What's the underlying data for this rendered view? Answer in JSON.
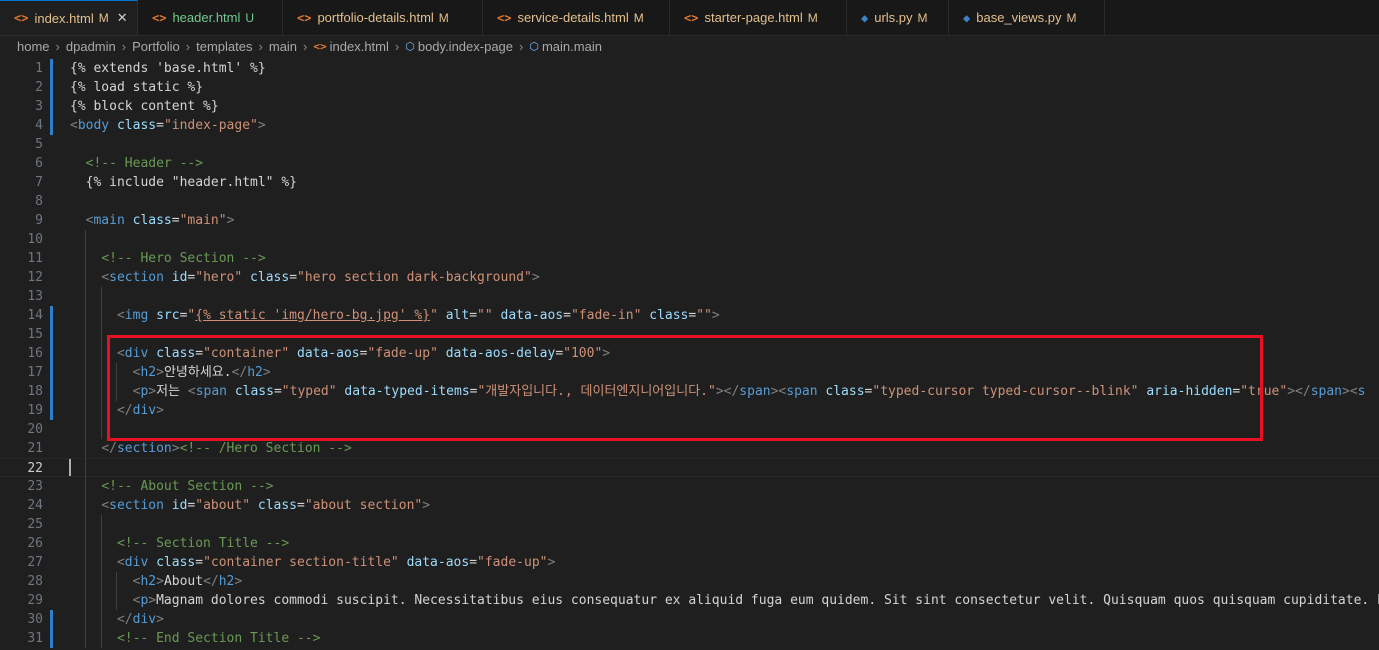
{
  "tabs": [
    {
      "icon": "html-file-icon",
      "icon_glyph": "<>",
      "name": "index.html",
      "badge": "M",
      "active": true,
      "close": "✕"
    },
    {
      "icon": "html-file-icon",
      "icon_glyph": "<>",
      "name": "header.html",
      "badge": "U",
      "active": false
    },
    {
      "icon": "html-file-icon",
      "icon_glyph": "<>",
      "name": "portfolio-details.html",
      "badge": "M",
      "active": false
    },
    {
      "icon": "html-file-icon",
      "icon_glyph": "<>",
      "name": "service-details.html",
      "badge": "M",
      "active": false
    },
    {
      "icon": "html-file-icon",
      "icon_glyph": "<>",
      "name": "starter-page.html",
      "badge": "M",
      "active": false
    },
    {
      "icon": "python-file-icon",
      "icon_glyph": "◆",
      "name": "urls.py",
      "badge": "M",
      "active": false
    },
    {
      "icon": "python-file-icon",
      "icon_glyph": "◆",
      "name": "base_views.py",
      "badge": "M",
      "active": false
    }
  ],
  "breadcrumb": [
    "home",
    "dpadmin",
    "Portfolio",
    "templates",
    "main",
    "index.html",
    "body.index-page",
    "main.main"
  ],
  "colors": {
    "accent": "#0078d4",
    "modified": "#e2c08d",
    "untracked": "#73c991",
    "highlight_box": "#e81123",
    "gutter_modified": "#2d7fca"
  },
  "lines": [
    {
      "n": "1",
      "segs": [
        [
          "t-tpl",
          "{% extends 'base.html' %}"
        ]
      ]
    },
    {
      "n": "2",
      "segs": [
        [
          "t-tpl",
          "{% load static %}"
        ]
      ]
    },
    {
      "n": "3",
      "segs": [
        [
          "t-tpl",
          "{% block content %}"
        ]
      ]
    },
    {
      "n": "4",
      "segs": [
        [
          "t-br",
          "<"
        ],
        [
          "t-tag",
          "body"
        ],
        [
          "t-text",
          " "
        ],
        [
          "t-attr",
          "class"
        ],
        [
          "t-text",
          "="
        ],
        [
          "t-str",
          "\"index-page\""
        ],
        [
          "t-br",
          ">"
        ]
      ]
    },
    {
      "n": "5",
      "segs": []
    },
    {
      "n": "6",
      "segs": [
        [
          "t-text",
          "  "
        ],
        [
          "t-com",
          "<!-- Header -->"
        ]
      ]
    },
    {
      "n": "7",
      "segs": [
        [
          "t-text",
          "  "
        ],
        [
          "t-tpl",
          "{% include \"header.html\" %}"
        ]
      ]
    },
    {
      "n": "8",
      "segs": []
    },
    {
      "n": "9",
      "segs": [
        [
          "t-text",
          "  "
        ],
        [
          "t-br",
          "<"
        ],
        [
          "t-tag",
          "main"
        ],
        [
          "t-text",
          " "
        ],
        [
          "t-attr",
          "class"
        ],
        [
          "t-text",
          "="
        ],
        [
          "t-str",
          "\"main\""
        ],
        [
          "t-br",
          ">"
        ]
      ]
    },
    {
      "n": "10",
      "segs": []
    },
    {
      "n": "11",
      "segs": [
        [
          "t-text",
          "    "
        ],
        [
          "t-com",
          "<!-- Hero Section -->"
        ]
      ]
    },
    {
      "n": "12",
      "segs": [
        [
          "t-text",
          "    "
        ],
        [
          "t-br",
          "<"
        ],
        [
          "t-tag",
          "section"
        ],
        [
          "t-text",
          " "
        ],
        [
          "t-attr",
          "id"
        ],
        [
          "t-text",
          "="
        ],
        [
          "t-str",
          "\"hero\""
        ],
        [
          "t-text",
          " "
        ],
        [
          "t-attr",
          "class"
        ],
        [
          "t-text",
          "="
        ],
        [
          "t-str",
          "\"hero section dark-background\""
        ],
        [
          "t-br",
          ">"
        ]
      ]
    },
    {
      "n": "13",
      "segs": []
    },
    {
      "n": "14",
      "segs": [
        [
          "t-text",
          "      "
        ],
        [
          "t-br",
          "<"
        ],
        [
          "t-tag",
          "img"
        ],
        [
          "t-text",
          " "
        ],
        [
          "t-attr",
          "src"
        ],
        [
          "t-text",
          "="
        ],
        [
          "t-str",
          "\""
        ],
        [
          "t-str t-und",
          "{% static 'img/hero-bg.jpg' %}"
        ],
        [
          "t-str",
          "\""
        ],
        [
          "t-text",
          " "
        ],
        [
          "t-attr",
          "alt"
        ],
        [
          "t-text",
          "="
        ],
        [
          "t-str",
          "\"\""
        ],
        [
          "t-text",
          " "
        ],
        [
          "t-attr",
          "data-aos"
        ],
        [
          "t-text",
          "="
        ],
        [
          "t-str",
          "\"fade-in\""
        ],
        [
          "t-text",
          " "
        ],
        [
          "t-attr",
          "class"
        ],
        [
          "t-text",
          "="
        ],
        [
          "t-str",
          "\"\""
        ],
        [
          "t-br",
          ">"
        ]
      ]
    },
    {
      "n": "15",
      "segs": []
    },
    {
      "n": "16",
      "segs": [
        [
          "t-text",
          "      "
        ],
        [
          "t-br",
          "<"
        ],
        [
          "t-tag",
          "div"
        ],
        [
          "t-text",
          " "
        ],
        [
          "t-attr",
          "class"
        ],
        [
          "t-text",
          "="
        ],
        [
          "t-str",
          "\"container\""
        ],
        [
          "t-text",
          " "
        ],
        [
          "t-attr",
          "data-aos"
        ],
        [
          "t-text",
          "="
        ],
        [
          "t-str",
          "\"fade-up\""
        ],
        [
          "t-text",
          " "
        ],
        [
          "t-attr",
          "data-aos-delay"
        ],
        [
          "t-text",
          "="
        ],
        [
          "t-str",
          "\"100\""
        ],
        [
          "t-br",
          ">"
        ]
      ]
    },
    {
      "n": "17",
      "segs": [
        [
          "t-text",
          "        "
        ],
        [
          "t-br",
          "<"
        ],
        [
          "t-tag",
          "h2"
        ],
        [
          "t-br",
          ">"
        ],
        [
          "t-text",
          "안녕하세요."
        ],
        [
          "t-br",
          "</"
        ],
        [
          "t-tag",
          "h2"
        ],
        [
          "t-br",
          ">"
        ]
      ]
    },
    {
      "n": "18",
      "segs": [
        [
          "t-text",
          "        "
        ],
        [
          "t-br",
          "<"
        ],
        [
          "t-tag",
          "p"
        ],
        [
          "t-br",
          ">"
        ],
        [
          "t-text",
          "저는 "
        ],
        [
          "t-br",
          "<"
        ],
        [
          "t-tag",
          "span"
        ],
        [
          "t-text",
          " "
        ],
        [
          "t-attr",
          "class"
        ],
        [
          "t-text",
          "="
        ],
        [
          "t-str",
          "\"typed\""
        ],
        [
          "t-text",
          " "
        ],
        [
          "t-attr",
          "data-typed-items"
        ],
        [
          "t-text",
          "="
        ],
        [
          "t-str",
          "\"개발자입니다., 데이터엔지니어입니다.\""
        ],
        [
          "t-br",
          "></"
        ],
        [
          "t-tag",
          "span"
        ],
        [
          "t-br",
          "><"
        ],
        [
          "t-tag",
          "span"
        ],
        [
          "t-text",
          " "
        ],
        [
          "t-attr",
          "class"
        ],
        [
          "t-text",
          "="
        ],
        [
          "t-str",
          "\"typed-cursor typed-cursor--blink\""
        ],
        [
          "t-text",
          " "
        ],
        [
          "t-attr",
          "aria-hidden"
        ],
        [
          "t-text",
          "="
        ],
        [
          "t-str",
          "\"true\""
        ],
        [
          "t-br",
          "></"
        ],
        [
          "t-tag",
          "span"
        ],
        [
          "t-br",
          "><"
        ],
        [
          "t-tag",
          "s"
        ]
      ]
    },
    {
      "n": "19",
      "segs": [
        [
          "t-text",
          "      "
        ],
        [
          "t-br",
          "</"
        ],
        [
          "t-tag",
          "div"
        ],
        [
          "t-br",
          ">"
        ]
      ]
    },
    {
      "n": "20",
      "segs": []
    },
    {
      "n": "21",
      "segs": [
        [
          "t-text",
          "    "
        ],
        [
          "t-br",
          "</"
        ],
        [
          "t-tag",
          "section"
        ],
        [
          "t-br",
          ">"
        ],
        [
          "t-com",
          "<!-- /Hero Section -->"
        ]
      ]
    },
    {
      "n": "22",
      "segs": []
    },
    {
      "n": "23",
      "segs": [
        [
          "t-text",
          "    "
        ],
        [
          "t-com",
          "<!-- About Section -->"
        ]
      ]
    },
    {
      "n": "24",
      "segs": [
        [
          "t-text",
          "    "
        ],
        [
          "t-br",
          "<"
        ],
        [
          "t-tag",
          "section"
        ],
        [
          "t-text",
          " "
        ],
        [
          "t-attr",
          "id"
        ],
        [
          "t-text",
          "="
        ],
        [
          "t-str",
          "\"about\""
        ],
        [
          "t-text",
          " "
        ],
        [
          "t-attr",
          "class"
        ],
        [
          "t-text",
          "="
        ],
        [
          "t-str",
          "\"about section\""
        ],
        [
          "t-br",
          ">"
        ]
      ]
    },
    {
      "n": "25",
      "segs": []
    },
    {
      "n": "26",
      "segs": [
        [
          "t-text",
          "      "
        ],
        [
          "t-com",
          "<!-- Section Title -->"
        ]
      ]
    },
    {
      "n": "27",
      "segs": [
        [
          "t-text",
          "      "
        ],
        [
          "t-br",
          "<"
        ],
        [
          "t-tag",
          "div"
        ],
        [
          "t-text",
          " "
        ],
        [
          "t-attr",
          "class"
        ],
        [
          "t-text",
          "="
        ],
        [
          "t-str",
          "\"container section-title\""
        ],
        [
          "t-text",
          " "
        ],
        [
          "t-attr",
          "data-aos"
        ],
        [
          "t-text",
          "="
        ],
        [
          "t-str",
          "\"fade-up\""
        ],
        [
          "t-br",
          ">"
        ]
      ]
    },
    {
      "n": "28",
      "segs": [
        [
          "t-text",
          "        "
        ],
        [
          "t-br",
          "<"
        ],
        [
          "t-tag",
          "h2"
        ],
        [
          "t-br",
          ">"
        ],
        [
          "t-text",
          "About"
        ],
        [
          "t-br",
          "</"
        ],
        [
          "t-tag",
          "h2"
        ],
        [
          "t-br",
          ">"
        ]
      ]
    },
    {
      "n": "29",
      "segs": [
        [
          "t-text",
          "        "
        ],
        [
          "t-br",
          "<"
        ],
        [
          "t-tag",
          "p"
        ],
        [
          "t-br",
          ">"
        ],
        [
          "t-text",
          "Magnam dolores commodi suscipit. Necessitatibus eius consequatur ex aliquid fuga eum quidem. Sit sint consectetur velit. Quisquam quos quisquam cupiditate. Et"
        ]
      ]
    },
    {
      "n": "30",
      "segs": [
        [
          "t-text",
          "      "
        ],
        [
          "t-br",
          "</"
        ],
        [
          "t-tag",
          "div"
        ],
        [
          "t-br",
          ">"
        ]
      ]
    },
    {
      "n": "31",
      "segs": [
        [
          "t-text",
          "      "
        ],
        [
          "t-com",
          "<!-- End Section Title -->"
        ]
      ]
    }
  ]
}
